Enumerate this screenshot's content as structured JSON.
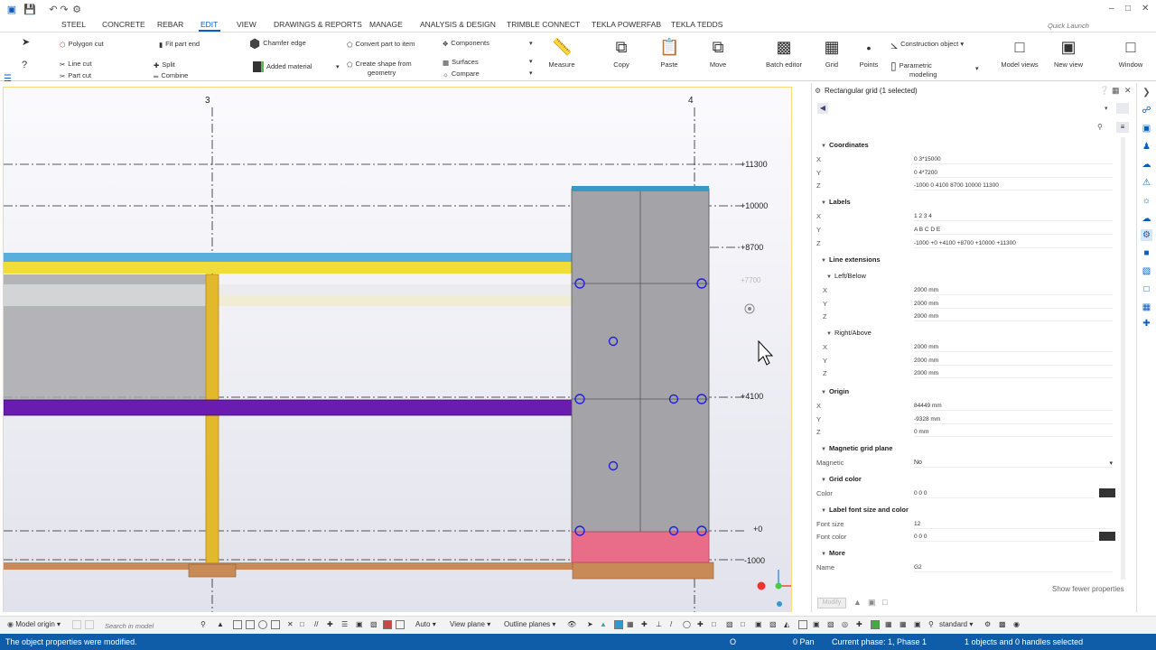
{
  "menubar": {
    "tabs": [
      {
        "label": "STEEL",
        "active": false
      },
      {
        "label": "CONCRETE",
        "active": false
      },
      {
        "label": "REBAR",
        "active": false
      },
      {
        "label": "EDIT",
        "active": true
      },
      {
        "label": "VIEW",
        "active": false
      },
      {
        "label": "DRAWINGS & REPORTS",
        "active": false
      },
      {
        "label": "MANAGE",
        "active": false
      },
      {
        "label": "ANALYSIS & DESIGN",
        "active": false
      },
      {
        "label": "TRIMBLE CONNECT",
        "active": false
      },
      {
        "label": "TEKLA POWERFAB",
        "active": false
      },
      {
        "label": "TEKLA TEDDS",
        "active": false
      }
    ],
    "quick_launch_placeholder": "Quick Launch"
  },
  "ribbon": {
    "polygon_cut": "Polygon cut",
    "line_cut": "Line cut",
    "part_cut": "Part cut",
    "fit_part_end": "Fit part end",
    "split": "Split",
    "combine": "Combine",
    "chamfer_edge": "Chamfer edge",
    "added_material": "Added material",
    "convert_part_to_item": "Convert part to item",
    "create_shape_from": "Create shape from",
    "geometry": "geometry",
    "components": "Components",
    "surfaces": "Surfaces",
    "compare": "Compare",
    "measure": "Measure",
    "copy": "Copy",
    "paste": "Paste",
    "move": "Move",
    "batch_editor": "Batch editor",
    "grid": "Grid",
    "points": "Points",
    "construction_object": "Construction object",
    "parametric": "Parametric",
    "modeling": "modeling",
    "model_views": "Model views",
    "new_view": "New view",
    "window": "Window"
  },
  "viewport": {
    "grid_labels": [
      "3",
      "4"
    ],
    "levels": [
      "+11300",
      "+10000",
      "+8700",
      "+7700",
      "+4100",
      "+0",
      "-1000"
    ]
  },
  "properties": {
    "title": "Rectangular grid (1 selected)",
    "coordinates": {
      "heading": "Coordinates",
      "x": "0 3*15000",
      "y": "0 4*7200",
      "z": "-1000 0 4100 8700 10000 11300"
    },
    "labels": {
      "heading": "Labels",
      "x": "1 2 3 4",
      "y": "A B C D E",
      "z": "-1000 +0 +4100 +8700 +10000 +11300"
    },
    "line_extensions": {
      "heading": "Line extensions",
      "left_below": {
        "heading": "Left/Below",
        "x": "2000 mm",
        "y": "2000 mm",
        "z": "2000 mm"
      },
      "right_above": {
        "heading": "Right/Above",
        "x": "2000 mm",
        "y": "2000 mm",
        "z": "2000 mm"
      }
    },
    "origin": {
      "heading": "Origin",
      "x": "84449 mm",
      "y": "-9328 mm",
      "z": "0 mm"
    },
    "magnetic": {
      "heading": "Magnetic grid plane",
      "label": "Magnetic",
      "value": "No"
    },
    "grid_color": {
      "heading": "Grid color",
      "label": "Color",
      "value": "0 0 0"
    },
    "label_font": {
      "heading": "Label font size and color",
      "size_label": "Font size",
      "size_value": "12",
      "color_label": "Font color",
      "color_value": "0 0 0"
    },
    "more": {
      "heading": "More",
      "name_label": "Name",
      "name_value": "G2"
    },
    "axis_x": "X",
    "axis_y": "Y",
    "axis_z": "Z",
    "show_fewer": "Show fewer properties",
    "modify": "Modify"
  },
  "bottombar": {
    "model_origin": "Model origin",
    "search_placeholder": "Search in model",
    "auto": "Auto",
    "view_plane": "View plane",
    "outline_planes": "Outline planes",
    "standard": "standard"
  },
  "statusbar": {
    "message": "The object properties were modified.",
    "mode": "O",
    "pan": "0 Pan",
    "phase": "Current phase: 1, Phase 1",
    "selection": "1 objects and 0 handles selected"
  },
  "colors": {
    "accent": "#0a5ebd",
    "statusbar": "#0f5da8",
    "beam_blue": "#5aaedc",
    "beam_yellow": "#f1dc3a",
    "beam_purple": "#6a1bb0",
    "column_yellow": "#e2b92b",
    "foundation_brown": "#c88a57",
    "footing_red": "#e96d88",
    "panel_gray": "#a3a3a8"
  }
}
